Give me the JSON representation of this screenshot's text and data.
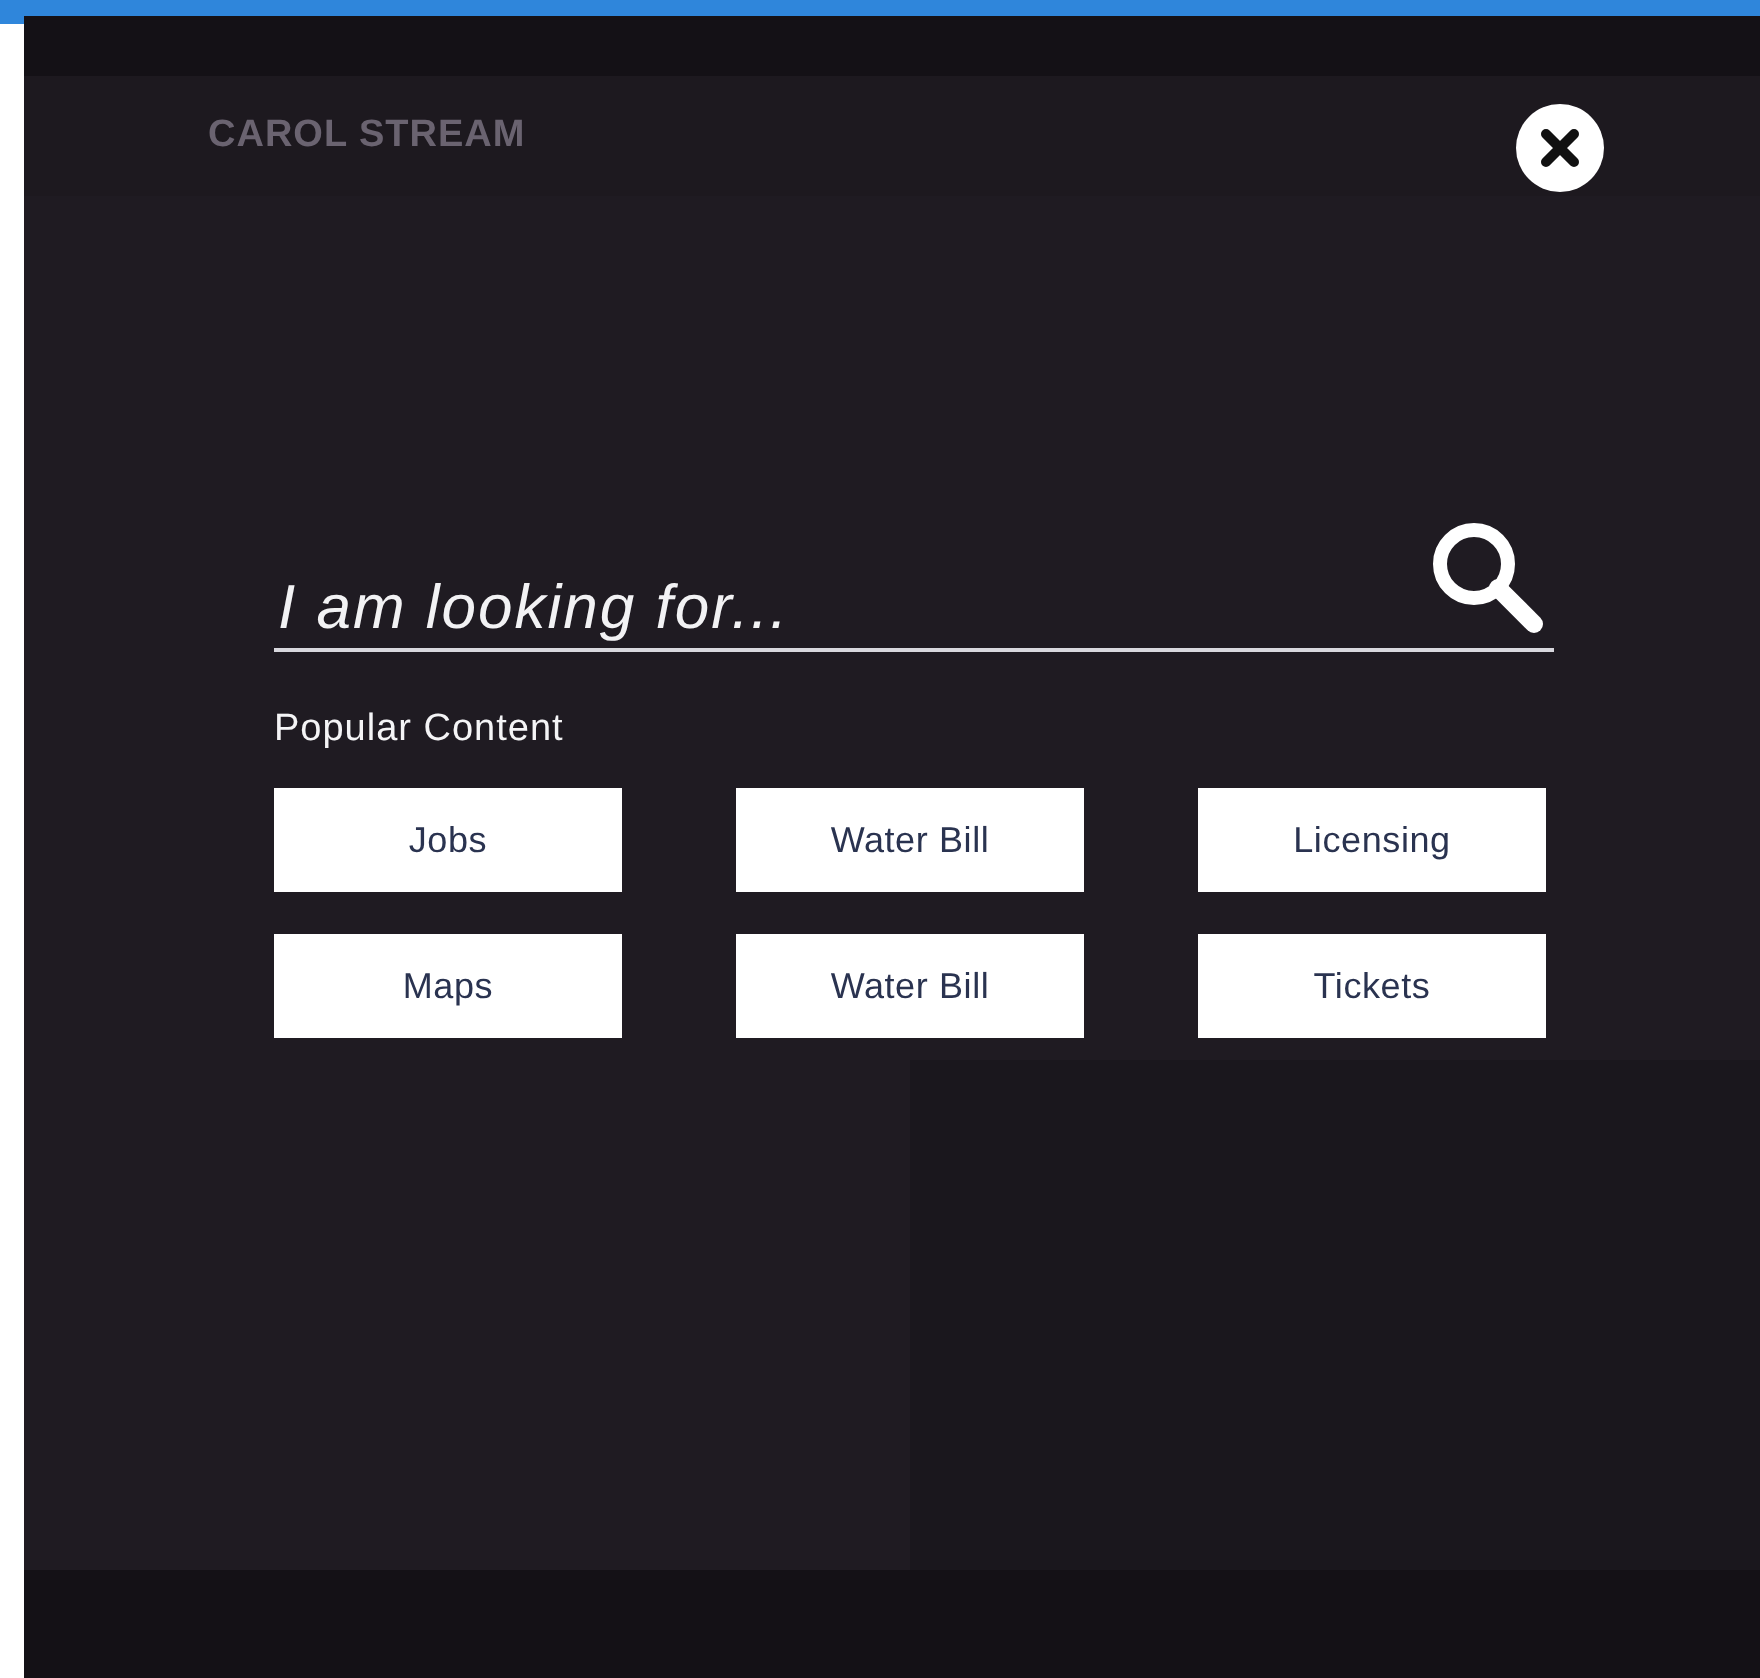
{
  "site": {
    "logo": "CAROL STREAM"
  },
  "search": {
    "placeholder": "I am looking for..."
  },
  "popular": {
    "heading": "Popular Content",
    "links": [
      {
        "label": "Jobs"
      },
      {
        "label": "Water Bill"
      },
      {
        "label": "Licensing"
      },
      {
        "label": "Maps"
      },
      {
        "label": "Water Bill"
      },
      {
        "label": "Tickets"
      }
    ]
  }
}
